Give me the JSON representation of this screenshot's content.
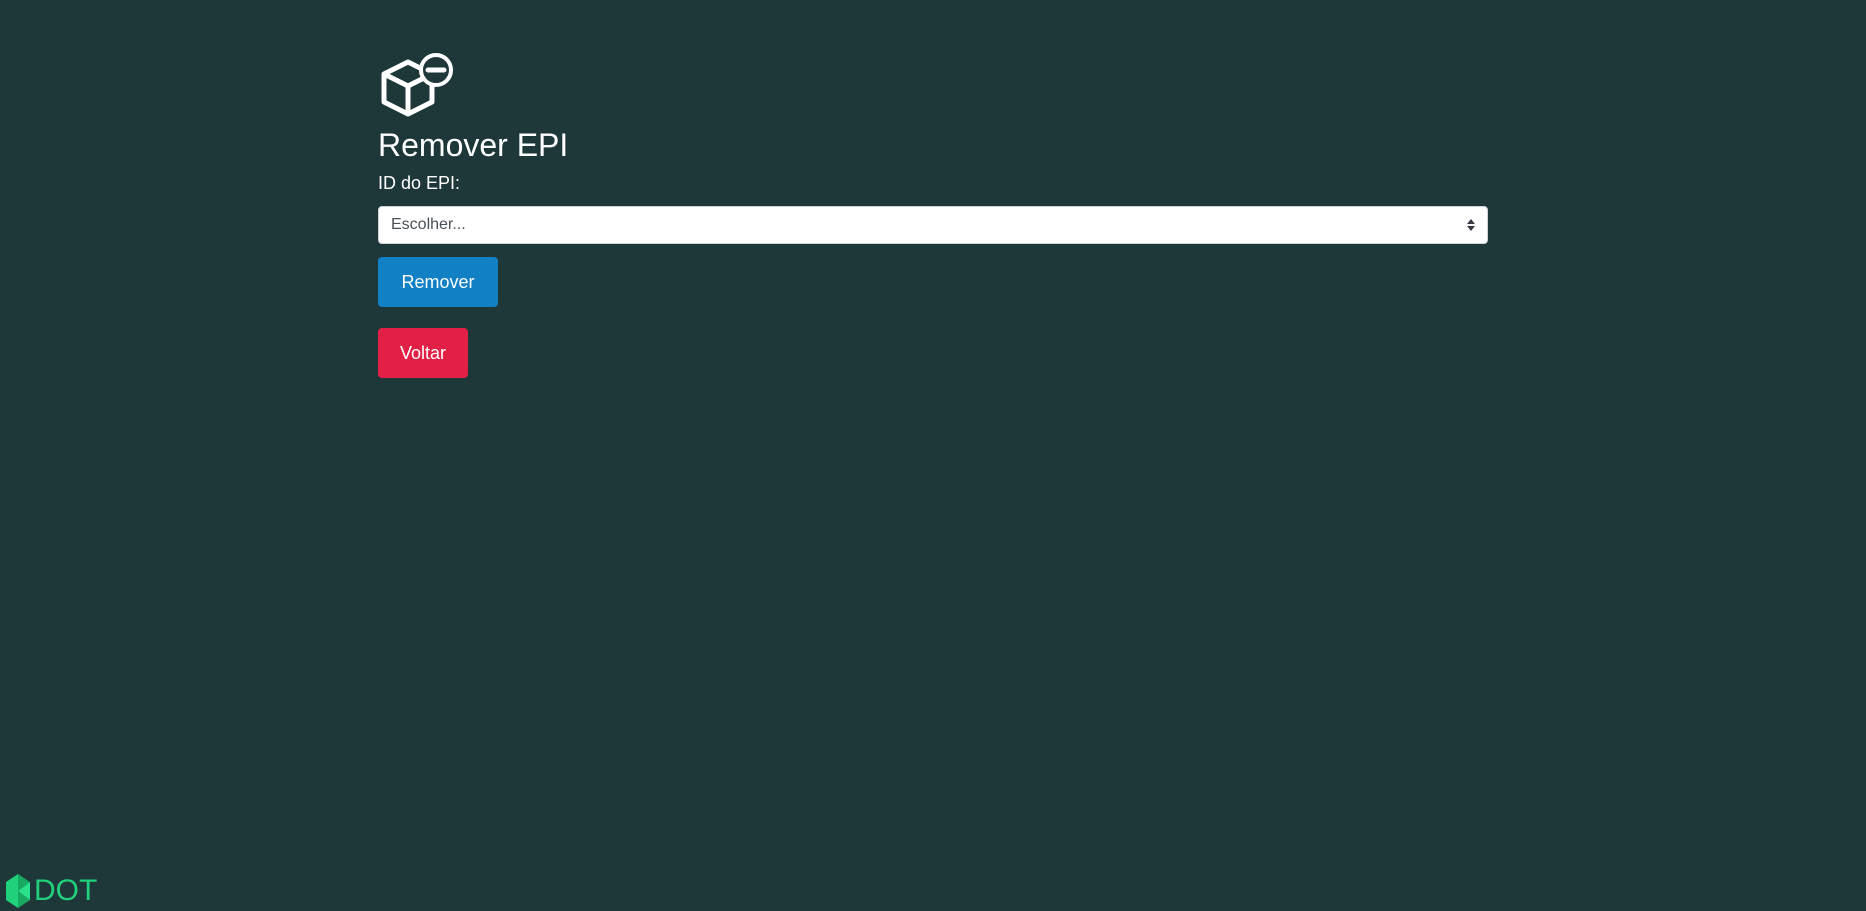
{
  "page": {
    "title": "Remover EPI",
    "header_icon": "box-remove-icon"
  },
  "form": {
    "id_label": "ID do EPI:",
    "select": {
      "selected": "Escolher...",
      "icon": "select-arrows-icon"
    },
    "remove_button": "Remover",
    "back_button": "Voltar"
  },
  "logo": {
    "text": "DOT",
    "icon": "logo-mark-icon"
  },
  "colors": {
    "background": "#1e3739",
    "remove_button": "#1180c4",
    "back_button": "#e21f45",
    "logo": "#21d07a"
  }
}
